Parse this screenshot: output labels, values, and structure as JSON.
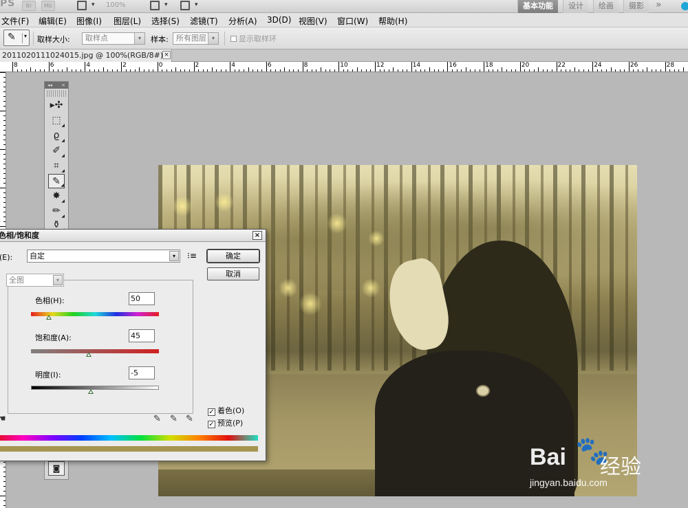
{
  "app": {
    "logo": "PS",
    "mini_buttons": [
      "Br",
      "Mb"
    ],
    "zoom": "100%",
    "workspaces": [
      "基本功能",
      "设计",
      "绘画",
      "摄影"
    ],
    "active_workspace": "基本功能",
    "more": "»",
    "accent": "#1ea7d6"
  },
  "menu": [
    "文件(F)",
    "编辑(E)",
    "图像(I)",
    "图层(L)",
    "选择(S)",
    "滤镜(T)",
    "分析(A)",
    "3D(D)",
    "视图(V)",
    "窗口(W)",
    "帮助(H)"
  ],
  "options": {
    "sample_size_label": "取样大小:",
    "sample_size_value": "取样点",
    "sample_label": "样本:",
    "sample_value": "所有图层",
    "show_ring_label": "显示取样环"
  },
  "document": {
    "tab_title": "20110201110240​15.jpg @ 100%(RGB/8#) *",
    "close": "×"
  },
  "ruler": {
    "h_labels": [
      "8",
      "6",
      "4",
      "2",
      "0",
      "2",
      "4",
      "6",
      "8",
      "10",
      "12",
      "14",
      "16",
      "18",
      "20",
      "22",
      "24",
      "26",
      "28"
    ]
  },
  "toolbox": {
    "collapse": "◂◂",
    "close": "×",
    "tools": [
      "move-icon",
      "marquee-icon",
      "lasso-icon",
      "quick-select-icon",
      "crop-icon",
      "eyedropper-icon",
      "healing-icon",
      "brush-icon",
      "stamp-icon"
    ]
  },
  "dialog": {
    "title": "色相/饱和度",
    "close": "×",
    "preset_label": "预设(E):",
    "preset_value": "自定",
    "channel_value": "全图",
    "ok": "确定",
    "cancel": "取消",
    "hue_label": "色相(H):",
    "hue_value": "50",
    "saturation_label": "饱和度(A):",
    "saturation_value": "45",
    "lightness_label": "明度(I):",
    "lightness_value": "-5",
    "colorize_label": "着色(O)",
    "colorize_checked": true,
    "preview_label": "预览(P)",
    "preview_checked": true,
    "check": "✓",
    "hue_pos": 0.14,
    "sat_pos": 0.45,
    "lig_pos": 0.47
  },
  "watermark": {
    "brand": "Bai",
    "brand2": "经验",
    "url": "jingyan.baidu.com"
  }
}
